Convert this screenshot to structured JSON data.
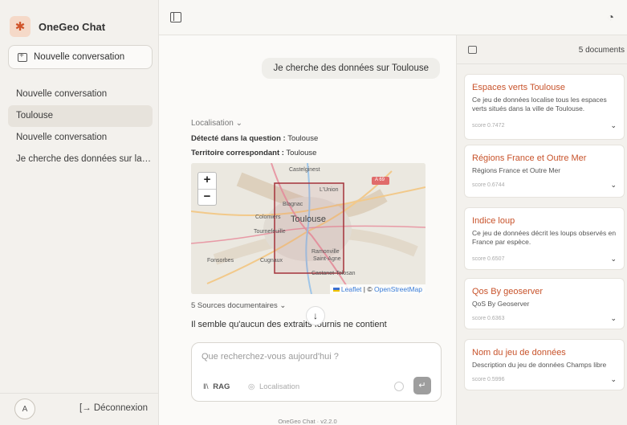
{
  "app": {
    "name": "OneGeo Chat"
  },
  "sidebar": {
    "new_conversation_label": "Nouvelle conversation",
    "conversations": [
      {
        "label": "Nouvelle conversation",
        "active": false
      },
      {
        "label": "Toulouse",
        "active": true
      },
      {
        "label": "Nouvelle conversation",
        "active": false
      },
      {
        "label": "Je cherche des données sur la r...",
        "active": false
      }
    ],
    "avatar_initial": "A",
    "logout_label": "[→ Déconnexion"
  },
  "chat": {
    "user_message": "Je cherche des données sur Toulouse",
    "localisation_label": "Localisation ⌄",
    "detected_label": "Détecté dans la question :",
    "detected_value": "Toulouse",
    "territory_label": "Territoire correspondant :",
    "territory_value": "Toulouse",
    "map": {
      "places": [
        "Castelginest",
        "L'Union",
        "A 69",
        "Blagnac",
        "Colomiers",
        "Toulouse",
        "Tournefeuille",
        "Ramonville",
        "Saint-Agne",
        "Fonsorbes",
        "Cugnaux",
        "Castanet-Tolosan"
      ],
      "attribution_leaflet": "Leaflet",
      "attribution_sep": " | © ",
      "attribution_osm": "OpenStreetMap",
      "zoom_in": "+",
      "zoom_out": "−"
    },
    "sources_label": "5 Sources documentaires ⌄",
    "answer_text": "Il semble qu'aucun des extraits fournis ne contient",
    "composer": {
      "placeholder": "Que recherchez-vous aujourd'hui ?",
      "rag_label": "RAG",
      "localisation_label": "Localisation"
    },
    "version": "OneGeo Chat · v2.2.0"
  },
  "documents": {
    "count_label": "5 documents",
    "items": [
      {
        "title": "Espaces verts Toulouse",
        "description": "Ce jeu de données localise tous les espaces verts situés dans la ville de Toulouse.",
        "score": "score 0.7472"
      },
      {
        "title": "Régions France et Outre Mer",
        "description": "Régions France et Outre Mer",
        "score": "score 0.6744"
      },
      {
        "title": "Indice loup",
        "description": "Ce jeu de données décrit les loups observés en France par espèce.",
        "score": "score 0.6507"
      },
      {
        "title": "Qos By geoserver",
        "description": "QoS By Geoserver",
        "score": "score 0.6363"
      },
      {
        "title": "Nom du jeu de données",
        "description": "Description du jeu de données Champs libre",
        "score": "score 0.5996"
      }
    ]
  },
  "colors": {
    "accent": "#c8532b",
    "map_highlight": "#a4323a"
  }
}
